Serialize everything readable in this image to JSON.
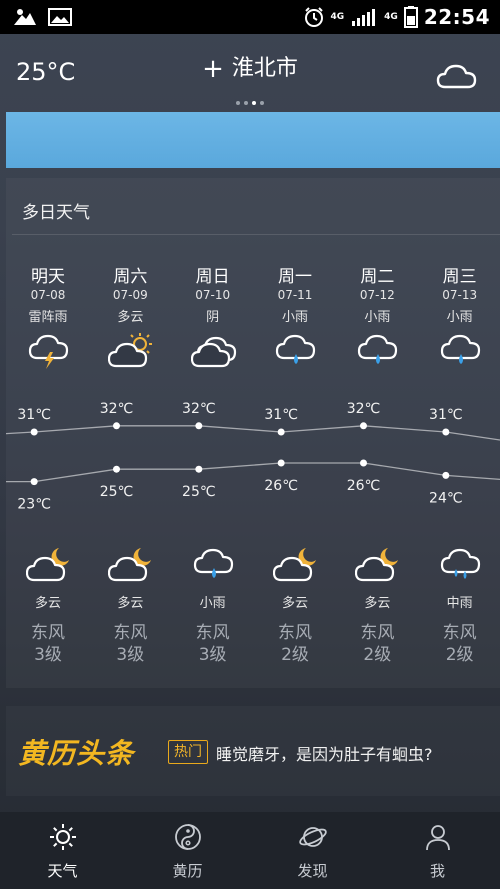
{
  "status_bar": {
    "network_top": "4G",
    "network_signal": "4G",
    "time": "22:54"
  },
  "header": {
    "current_temp": "25°C",
    "add_icon": "plus-icon",
    "city": "淮北市",
    "page_count": 4,
    "active_page": 3,
    "weather_icon": "cloud-icon"
  },
  "forecast": {
    "title": "多日天气",
    "days": [
      {
        "name": "明天",
        "date": "07-08",
        "day_cond": "雷阵雨",
        "day_icon": "thunderstorm",
        "high": "31℃",
        "low": "23℃",
        "night_icon": "partly-cloudy-night",
        "night_cond": "多云",
        "wind_dir": "东风",
        "wind_level": "3级"
      },
      {
        "name": "周六",
        "date": "07-09",
        "day_cond": "多云",
        "day_icon": "partly-cloudy-day",
        "high": "32℃",
        "low": "25℃",
        "night_icon": "partly-cloudy-night",
        "night_cond": "多云",
        "wind_dir": "东风",
        "wind_level": "3级"
      },
      {
        "name": "周日",
        "date": "07-10",
        "day_cond": "阴",
        "day_icon": "overcast",
        "high": "32℃",
        "low": "25℃",
        "night_icon": "light-rain",
        "night_cond": "小雨",
        "wind_dir": "东风",
        "wind_level": "3级"
      },
      {
        "name": "周一",
        "date": "07-11",
        "day_cond": "小雨",
        "day_icon": "light-rain",
        "high": "31℃",
        "low": "26℃",
        "night_icon": "partly-cloudy-night",
        "night_cond": "多云",
        "wind_dir": "东风",
        "wind_level": "2级"
      },
      {
        "name": "周二",
        "date": "07-12",
        "day_cond": "小雨",
        "day_icon": "light-rain",
        "high": "32℃",
        "low": "26℃",
        "night_icon": "partly-cloudy-night",
        "night_cond": "多云",
        "wind_dir": "东风",
        "wind_level": "2级"
      },
      {
        "name": "周三",
        "date": "07-13",
        "day_cond": "小雨",
        "day_icon": "light-rain",
        "high": "31℃",
        "low": "24℃",
        "night_icon": "moderate-rain",
        "night_cond": "中雨",
        "wind_dir": "东风",
        "wind_level": "2级"
      }
    ]
  },
  "chart_data": {
    "type": "line",
    "categories": [
      "07-08",
      "07-09",
      "07-10",
      "07-11",
      "07-12",
      "07-13"
    ],
    "series": [
      {
        "values": [
          31,
          32,
          32,
          31,
          32,
          31
        ]
      },
      {
        "values": [
          23,
          25,
          25,
          26,
          26,
          24
        ]
      }
    ]
  },
  "headline": {
    "logo": "黄历头条",
    "tag": "热门",
    "text": "睡觉磨牙，是因为肚子有蛔虫?"
  },
  "nav": [
    {
      "label": "天气",
      "icon": "sun-icon",
      "active": true
    },
    {
      "label": "黄历",
      "icon": "yin-yang-icon",
      "active": false
    },
    {
      "label": "发现",
      "icon": "planet-icon",
      "active": false
    },
    {
      "label": "我",
      "icon": "person-icon",
      "active": false
    }
  ],
  "colors": {
    "accent": "#f3b721",
    "banner": "#5aa8dc",
    "rain_drop": "#3aa0e8",
    "moon": "#f0b33a"
  }
}
